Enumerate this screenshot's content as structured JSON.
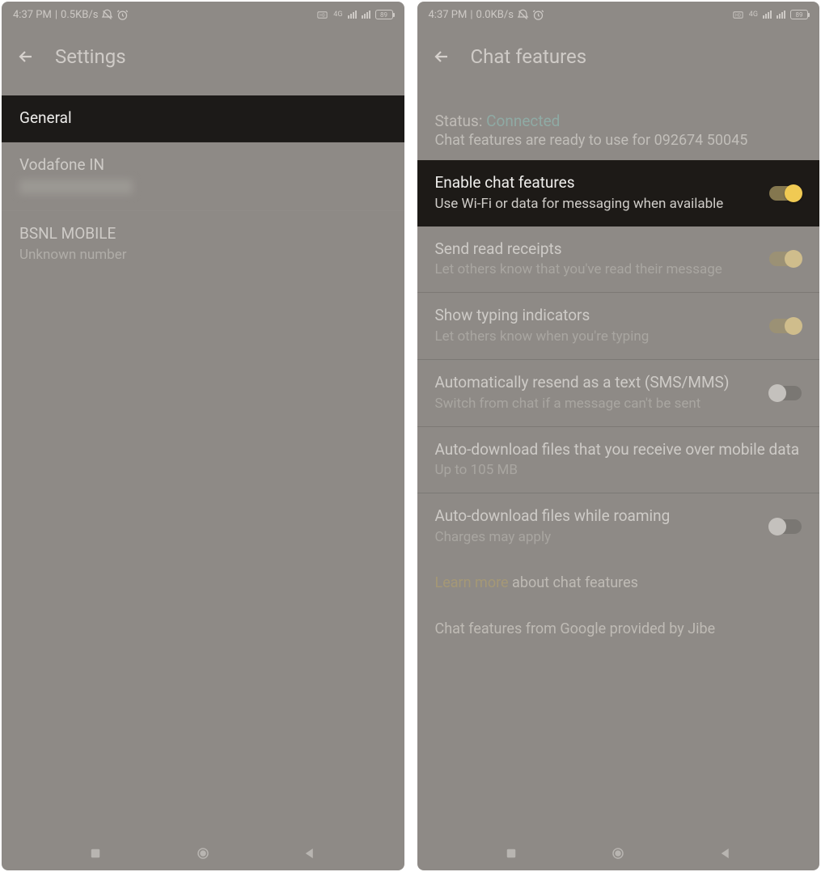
{
  "left": {
    "status": {
      "time": "4:37 PM",
      "rate": "0.5KB/s",
      "net": "4G",
      "battery": "89"
    },
    "title": "Settings",
    "items": [
      {
        "title": "General",
        "sub": "",
        "highlight": true
      },
      {
        "title": "Vodafone IN",
        "sub": "",
        "blur": true
      },
      {
        "title": "BSNL MOBILE",
        "sub": "Unknown number"
      }
    ]
  },
  "right": {
    "status": {
      "time": "4:37 PM",
      "rate": "0.0KB/s",
      "net": "4G",
      "battery": "89"
    },
    "title": "Chat features",
    "statusLabel": "Status: ",
    "statusValue": "Connected",
    "statusLine2": "Chat features are ready to use for 092674 50045",
    "items": [
      {
        "title": "Enable chat features",
        "sub": "Use Wi-Fi or data for messaging when available",
        "toggle": "on",
        "highlight": true
      },
      {
        "title": "Send read receipts",
        "sub": "Let others know that you've read their message",
        "toggle": "ondim"
      },
      {
        "title": "Show typing indicators",
        "sub": "Let others know when you're typing",
        "toggle": "ondim"
      },
      {
        "title": "Automatically resend as a text (SMS/MMS)",
        "sub": "Switch from chat if a message can't be sent",
        "toggle": "off"
      },
      {
        "title": "Auto-download files that you receive over mobile data",
        "sub": "Up to 105 MB"
      },
      {
        "title": "Auto-download files while roaming",
        "sub": "Charges may apply",
        "toggle": "off"
      }
    ],
    "learnLink": "Learn more",
    "learnRest": " about chat features",
    "provided": "Chat features from Google provided by Jibe"
  }
}
